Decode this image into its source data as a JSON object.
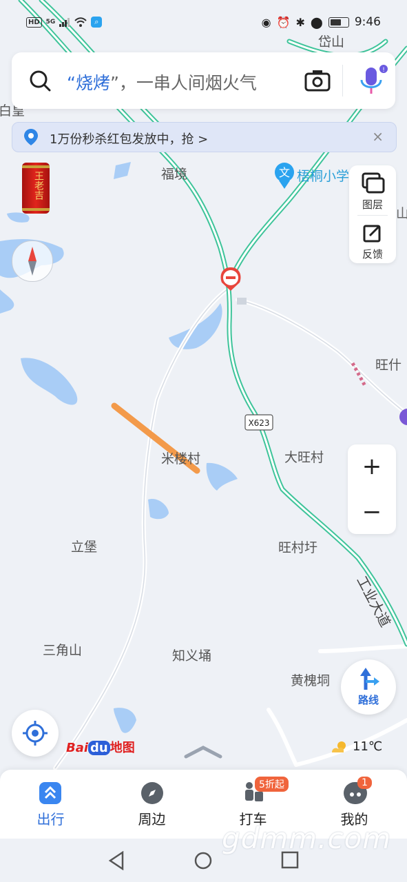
{
  "status_bar": {
    "left": "HD",
    "signal": "5G",
    "time": "9:46",
    "battery_level": 0.7
  },
  "search": {
    "prefix_quote": "“",
    "keyword": "烧烤",
    "suffix": "”，一串人间烟火气"
  },
  "promo": {
    "text": "1万份秒杀红包发放中，抢 >",
    "close": "×"
  },
  "side_panel": {
    "layers_label": "图层",
    "feedback_label": "反馈"
  },
  "zoom": {
    "plus": "+",
    "minus": "−"
  },
  "route": {
    "label": "路线"
  },
  "map": {
    "labels": {
      "daishan": "岱山",
      "baihuang": "白皇",
      "fujing": "福境",
      "wutong_school": "梧桐小学",
      "wangshi": "旺什",
      "milou": "米楼村",
      "dawang": "大旺村",
      "libao": "立堡",
      "wangcunxu": "旺村圩",
      "sanjiaoshan": "三角山",
      "zhiyiyong": "知义埇",
      "huanghuaidong": "黄槐垌",
      "gongye_road": "工业大道",
      "shan_edge": "山"
    },
    "road_shield": "X623",
    "school_icon_char": "文"
  },
  "brand": {
    "logo_text_1": "Bai",
    "logo_text_du": "du",
    "logo_text_2": "地图"
  },
  "weather": {
    "temp": "11℃"
  },
  "promo_can": {
    "text": "王老吉"
  },
  "tabs": [
    {
      "label": "出行",
      "active": true
    },
    {
      "label": "周边",
      "active": false
    },
    {
      "label": "打车",
      "active": false,
      "badge": "5折起"
    },
    {
      "label": "我的",
      "active": false,
      "badge": "1"
    }
  ],
  "watermark": "gdmm.com",
  "colors": {
    "highway": "#3ec49a",
    "water": "#a9cdf6",
    "accent": "#2f6fd9",
    "route_orange": "#f39a4a",
    "tab_active": "#2f6fd9"
  }
}
